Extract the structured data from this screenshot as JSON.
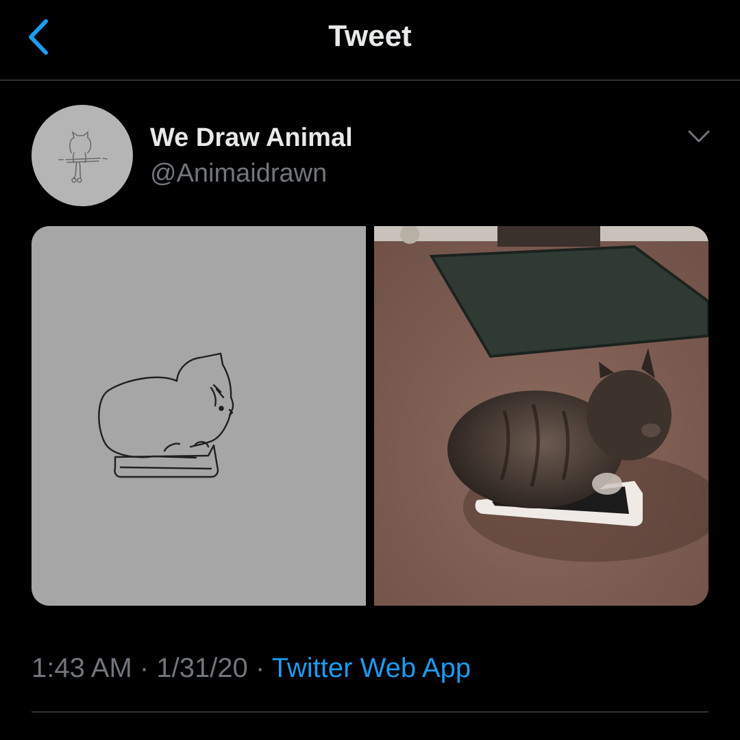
{
  "nav": {
    "title": "Tweet",
    "back_icon": "chevron-left-icon"
  },
  "author": {
    "name": "We Draw Animal",
    "handle": "@Animaidrawn",
    "avatar_icon": "cat-sketch-avatar"
  },
  "media": [
    {
      "kind": "drawing",
      "subject": "cat-on-phone-sketch"
    },
    {
      "kind": "photo",
      "subject": "kitten-on-phone-photo"
    }
  ],
  "meta": {
    "time": "1:43 AM",
    "separator": "·",
    "date": "1/31/20",
    "source": "Twitter Web App"
  },
  "colors": {
    "background": "#000000",
    "text_primary": "#e7e9ea",
    "text_secondary": "#71767b",
    "accent": "#1d9bf0",
    "divider": "#2f3336"
  }
}
